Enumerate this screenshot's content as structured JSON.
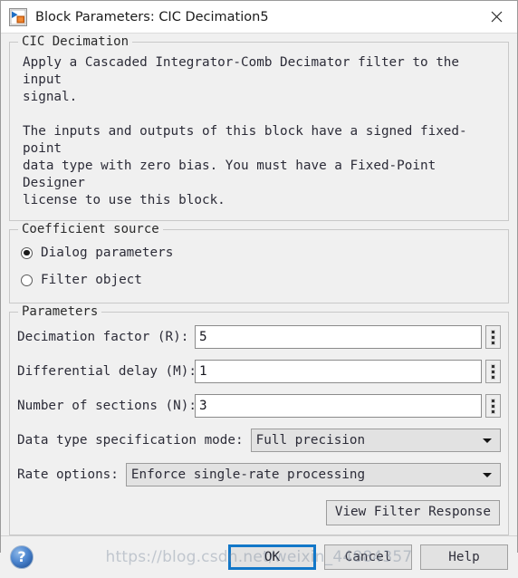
{
  "window": {
    "title": "Block Parameters: CIC Decimation5",
    "icon": "simulink-block-icon",
    "close_label": "×"
  },
  "description": {
    "group_title": "CIC Decimation",
    "paragraphs": [
      "Apply a Cascaded Integrator-Comb Decimator filter to the input\nsignal.",
      "The inputs and outputs of this block have a signed fixed-point\ndata type with zero bias. You must have a Fixed-Point Designer\nlicense to use this block."
    ]
  },
  "coefficient_source": {
    "group_title": "Coefficient source",
    "options": [
      {
        "label": "Dialog parameters",
        "selected": true
      },
      {
        "label": "Filter object",
        "selected": false
      }
    ]
  },
  "parameters": {
    "group_title": "Parameters",
    "fields": [
      {
        "label": "Decimation factor (R):",
        "value": "5",
        "type": "text",
        "spinner": "three-dots"
      },
      {
        "label": "Differential delay (M):",
        "value": "1",
        "type": "text",
        "spinner": "three-dots"
      },
      {
        "label": "Number of sections (N):",
        "value": "3",
        "type": "text",
        "spinner": "three-dots"
      }
    ],
    "dropdowns": [
      {
        "label": "Data type specification mode:",
        "value": "Full precision"
      },
      {
        "label": "Rate options:",
        "value": "Enforce single-rate processing"
      }
    ],
    "view_filter_response_label": "View Filter Response"
  },
  "footer": {
    "help_icon_label": "?",
    "buttons": [
      {
        "label": "OK",
        "primary": true
      },
      {
        "label": "Cancel",
        "primary": false
      },
      {
        "label": "Help",
        "primary": false
      }
    ],
    "watermark": "https://blog.csdn.net/weixin_44884357"
  },
  "colors": {
    "accent_focus": "#1277c8",
    "dialog_bg": "#f0f0f0",
    "input_bg": "#ffffff",
    "combo_bg": "#e2e2e2",
    "group_border": "#c8c8c8"
  }
}
